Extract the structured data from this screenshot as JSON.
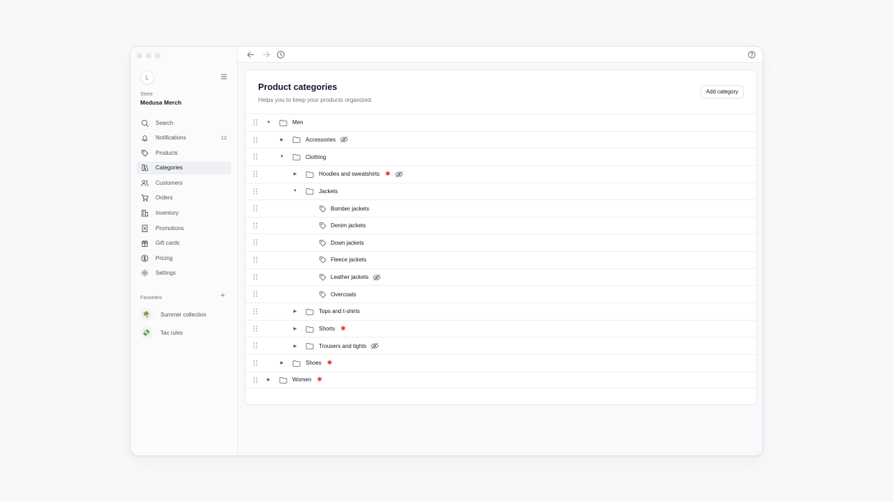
{
  "sidebar": {
    "avatar_initial": "L",
    "store_label": "Store",
    "store_name": "Medusa Merch",
    "nav": [
      {
        "label": "Search",
        "icon": "search-icon"
      },
      {
        "label": "Notifications",
        "icon": "bell-icon",
        "count": "12"
      },
      {
        "label": "Products",
        "icon": "tag-icon"
      },
      {
        "label": "Categories",
        "icon": "categories-icon",
        "active": true
      },
      {
        "label": "Customers",
        "icon": "users-icon"
      },
      {
        "label": "Orders",
        "icon": "cart-icon"
      },
      {
        "label": "Inventory",
        "icon": "building-icon"
      },
      {
        "label": "Promotions",
        "icon": "receipt-icon"
      },
      {
        "label": "Gift cards",
        "icon": "gift-icon"
      },
      {
        "label": "Pricing",
        "icon": "dollar-icon"
      },
      {
        "label": "Settings",
        "icon": "gear-icon"
      }
    ],
    "favorites_label": "Favorites",
    "favorites_add": "+",
    "favorites": [
      {
        "label": "Summer collection",
        "emoji": "🌴"
      },
      {
        "label": "Tax rules",
        "emoji": "💸"
      }
    ]
  },
  "page": {
    "title": "Product categories",
    "subtitle": "Helps you to keep your products organized.",
    "add_button": "Add category"
  },
  "tree": [
    {
      "label": "Men",
      "level": 0,
      "caret": "open",
      "icon": "folder",
      "star": false,
      "hidden": false
    },
    {
      "label": "Accessories",
      "level": 1,
      "caret": "closed",
      "icon": "folder",
      "star": false,
      "hidden": true
    },
    {
      "label": "Clothing",
      "level": 1,
      "caret": "open",
      "icon": "folder",
      "star": false,
      "hidden": false
    },
    {
      "label": "Hoodies and sweatshirts",
      "level": 2,
      "caret": "closed",
      "icon": "folder",
      "star": true,
      "hidden": true
    },
    {
      "label": "Jackets",
      "level": 2,
      "caret": "open",
      "icon": "folder",
      "star": false,
      "hidden": false
    },
    {
      "label": "Bomber jackets",
      "level": 3,
      "caret": "none",
      "icon": "tag",
      "star": false,
      "hidden": false
    },
    {
      "label": "Denim jackets",
      "level": 3,
      "caret": "none",
      "icon": "tag",
      "star": false,
      "hidden": false
    },
    {
      "label": "Down jackets",
      "level": 3,
      "caret": "none",
      "icon": "tag",
      "star": false,
      "hidden": false
    },
    {
      "label": "Fleece jackets",
      "level": 3,
      "caret": "none",
      "icon": "tag",
      "star": false,
      "hidden": false
    },
    {
      "label": "Leather jackets",
      "level": 3,
      "caret": "none",
      "icon": "tag",
      "star": false,
      "hidden": true
    },
    {
      "label": "Overcoats",
      "level": 3,
      "caret": "none",
      "icon": "tag",
      "star": false,
      "hidden": false
    },
    {
      "label": "Tops and t-shirts",
      "level": 2,
      "caret": "closed",
      "icon": "folder",
      "star": false,
      "hidden": false
    },
    {
      "label": "Shorts",
      "level": 2,
      "caret": "closed",
      "icon": "folder",
      "star": true,
      "hidden": false
    },
    {
      "label": "Trousers and tights",
      "level": 2,
      "caret": "closed",
      "icon": "folder",
      "star": false,
      "hidden": true
    },
    {
      "label": "Shoes",
      "level": 1,
      "caret": "closed",
      "icon": "folder",
      "star": true,
      "hidden": false
    },
    {
      "label": "Women",
      "level": 0,
      "caret": "closed",
      "icon": "folder",
      "star": true,
      "hidden": false
    }
  ],
  "colors": {
    "accent_star": "#e0322b",
    "active_bg": "#eef0f3"
  }
}
